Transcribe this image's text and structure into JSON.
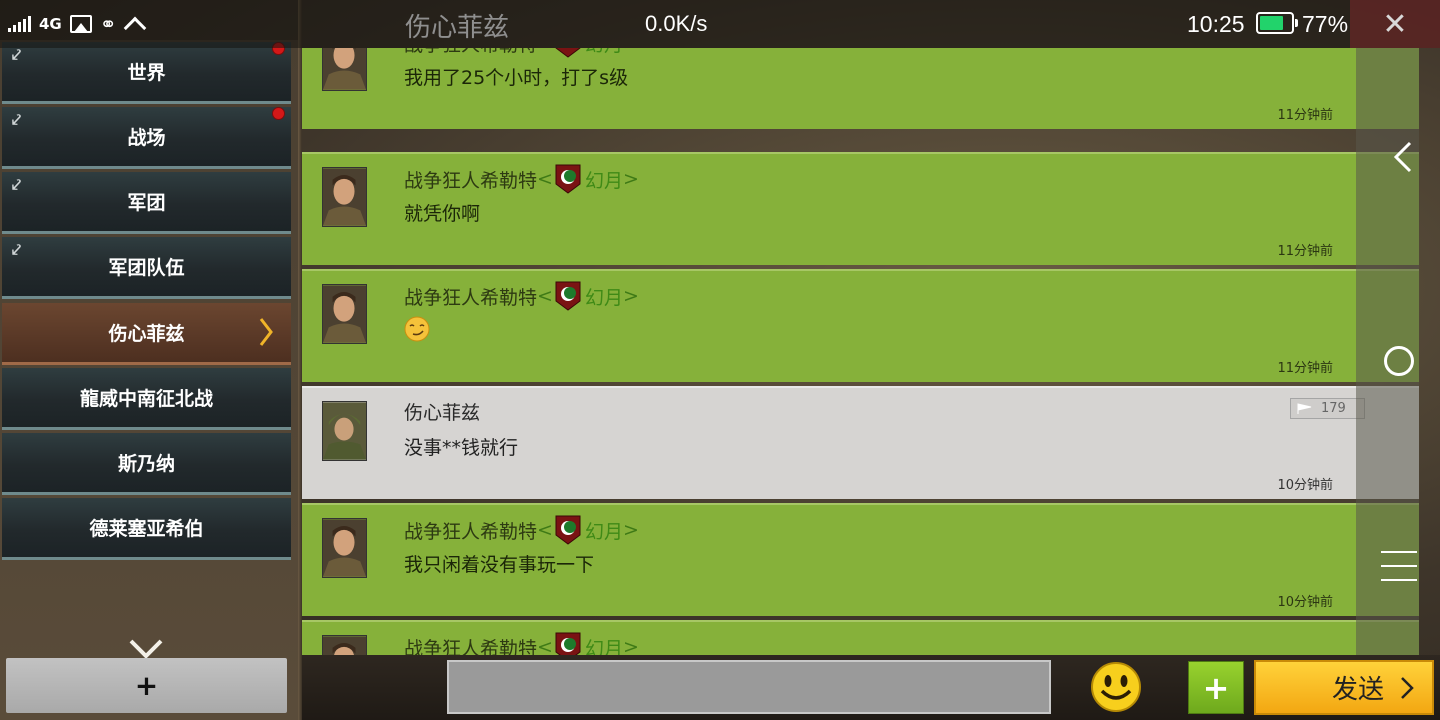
{
  "statusbar": {
    "network": "4G",
    "title": "伤心菲兹",
    "speed": "0.0K/s",
    "time": "10:25",
    "battery_percent": "77%",
    "battery_level": 0.77
  },
  "sidebar": {
    "items": [
      {
        "label": "世界"
      },
      {
        "label": "战场"
      },
      {
        "label": "军团"
      },
      {
        "label": "军团队伍"
      },
      {
        "label": "伤心菲兹"
      },
      {
        "label": "龍威中南征北战"
      },
      {
        "label": "斯乃纳"
      },
      {
        "label": "德莱塞亚希伯"
      }
    ],
    "add_label": "+"
  },
  "messages": [
    {
      "sender": "战争狂人希勒特",
      "guild": "幻月",
      "text": "我用了25个小时，打了s级",
      "time": "11分钟前"
    },
    {
      "sender": "战争狂人希勒特",
      "guild": "幻月",
      "text": "就凭你啊",
      "time": "11分钟前"
    },
    {
      "sender": "战争狂人希勒特",
      "guild": "幻月",
      "emoji": "smirk-emoji",
      "time": "11分钟前"
    },
    {
      "sender": "伤心菲兹",
      "text": "没事**钱就行",
      "time": "10分钟前",
      "views": "179"
    },
    {
      "sender": "战争狂人希勒特",
      "guild": "幻月",
      "text": "我只闲着没有事玩一下",
      "time": "10分钟前"
    },
    {
      "sender": "战争狂人希勒特",
      "guild": "幻月"
    }
  ],
  "input": {
    "send_label": "发送",
    "attach_label": "+"
  },
  "colors": {
    "message_bg": "#86b13a",
    "own_message_bg": "#d6d4d2",
    "send_button": "#f8bf22",
    "unread_dot": "#d41818",
    "battery": "#22d36b"
  }
}
